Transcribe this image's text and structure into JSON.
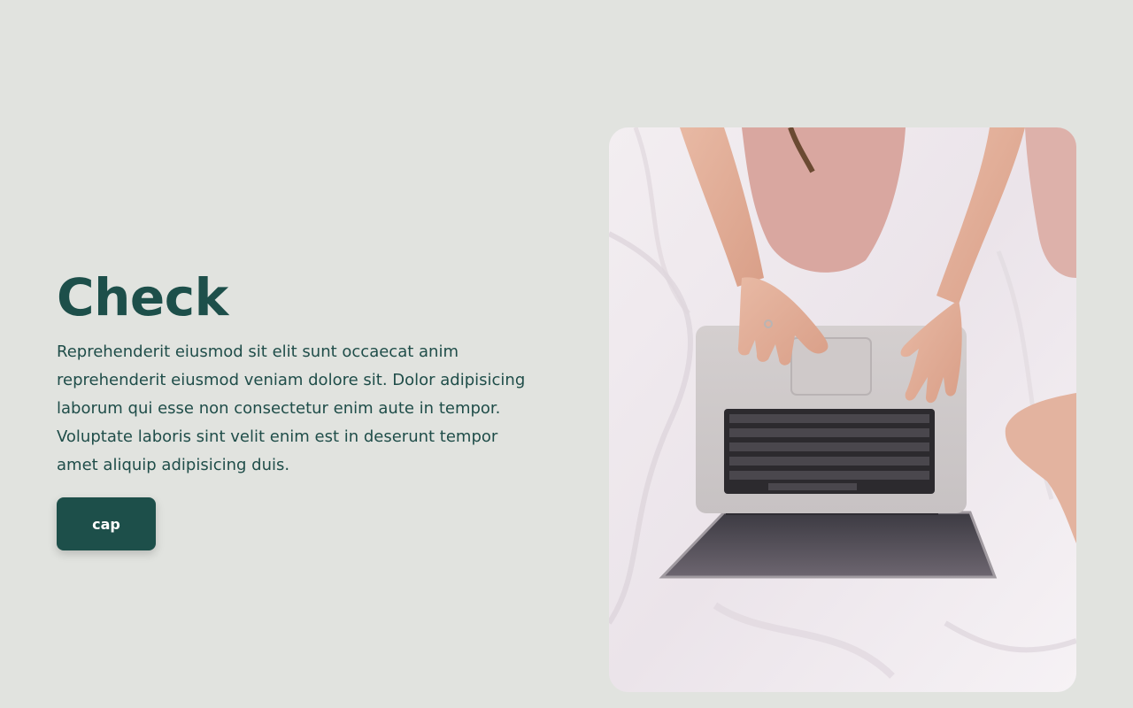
{
  "hero": {
    "title": "Check",
    "body": "Reprehenderit eiusmod sit elit sunt occaecat anim reprehenderit eiusmod veniam dolore sit. Dolor adipisicing laborum qui esse non consectetur enim aute in tempor. Voluptate laboris sint velit enim est in deserunt tempor amet aliquip adipisicing duis.",
    "button_label": "cap"
  },
  "photo": {
    "subject": "person-typing-on-laptop-on-bed"
  },
  "colors": {
    "background": "#e1e3df",
    "brand_green": "#1d4f4a",
    "button_text": "#ffffff"
  }
}
